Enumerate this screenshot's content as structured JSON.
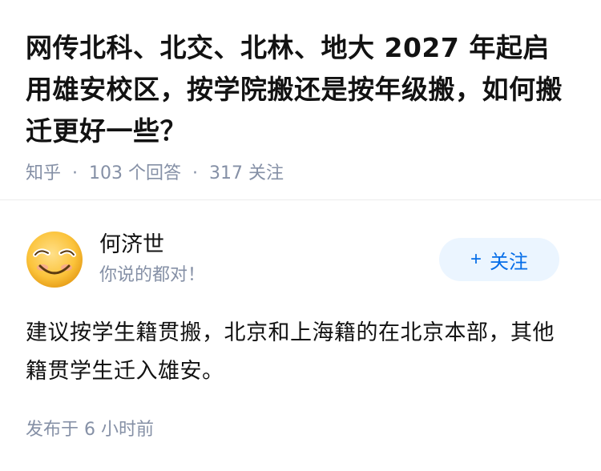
{
  "question": {
    "title": "网传北科、北交、北林、地大 2027 年起启用雄安校区，按学院搬还是按年级搬，如何搬迁更好一些？",
    "source": "知乎",
    "answer_count": "103 个回答",
    "follower_count": "317 关注"
  },
  "answer": {
    "author_name": "何济世",
    "author_bio": "你说的都对！",
    "follow_label": "关注",
    "follow_icon": "plus-icon",
    "content": "建议按学生籍贯搬，北京和上海籍的在北京本部，其他籍贯学生迁入雄安。",
    "published": "发布于  6 小时前"
  },
  "colors": {
    "text_primary": "#121212",
    "text_meta": "#8590a6",
    "accent_blue": "#056de8",
    "follow_bg": "#ebf5ff"
  }
}
